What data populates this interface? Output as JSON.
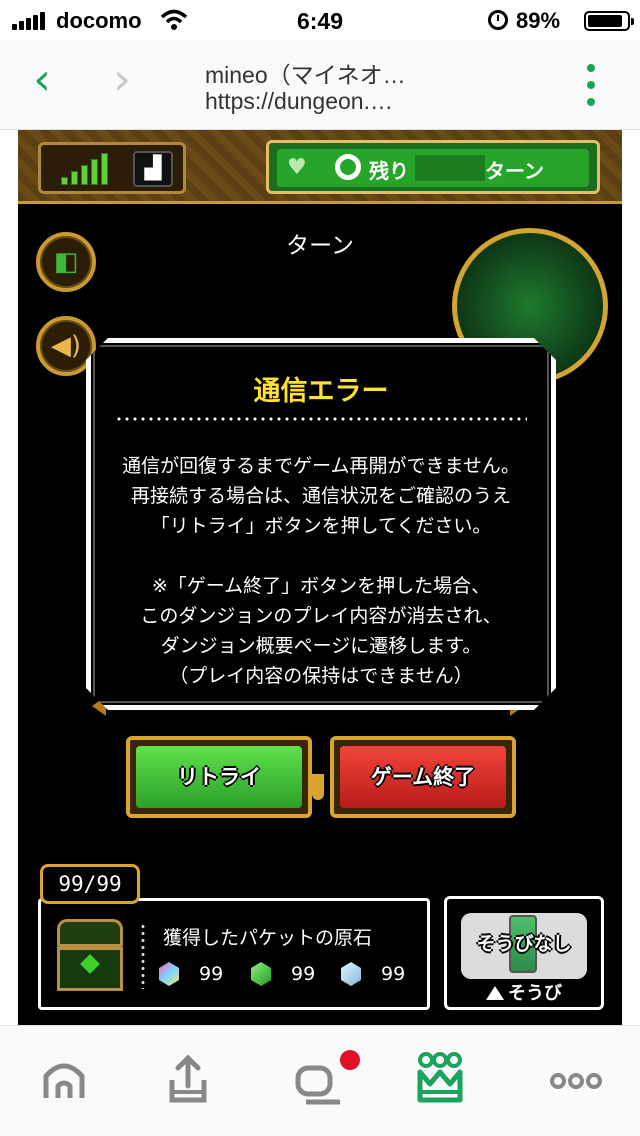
{
  "status_bar": {
    "carrier": "docomo",
    "time": "6:49",
    "battery": "89%",
    "battery_level": 0.89
  },
  "browser": {
    "title": "mineo（マイネオ…",
    "url": "https://dungeon.…"
  },
  "hud": {
    "remaining_label": "残り",
    "turn_label": "ターン"
  },
  "game": {
    "turn_text": "ターン"
  },
  "dialog": {
    "title": "通信エラー",
    "body": "通信が回復するまでゲーム再開ができません。\n再接続する場合は、通信状況をご確認のうえ\n「リトライ」ボタンを押してください。\n\n※「ゲーム終了」ボタンを押した場合、\nこのダンジョンのプレイ内容が消去され、\nダンジョン概要ページに遷移します。\n（プレイ内容の保持はできません）"
  },
  "buttons": {
    "retry": "リトライ",
    "quit": "ゲーム終了"
  },
  "inventory": {
    "count": "99/99",
    "title": "獲得したパケットの原石",
    "stones": [
      {
        "icon": "rainbow-stone-icon",
        "value": "99"
      },
      {
        "icon": "green-stone-icon",
        "value": "99"
      },
      {
        "icon": "blue-stone-icon",
        "value": "99"
      }
    ]
  },
  "equipment": {
    "card_text": "そうびなし",
    "label": "そうび"
  },
  "tabbar": [
    "home-tab",
    "upload-tab",
    "chat-tab",
    "crown-tab",
    "more-tab"
  ]
}
